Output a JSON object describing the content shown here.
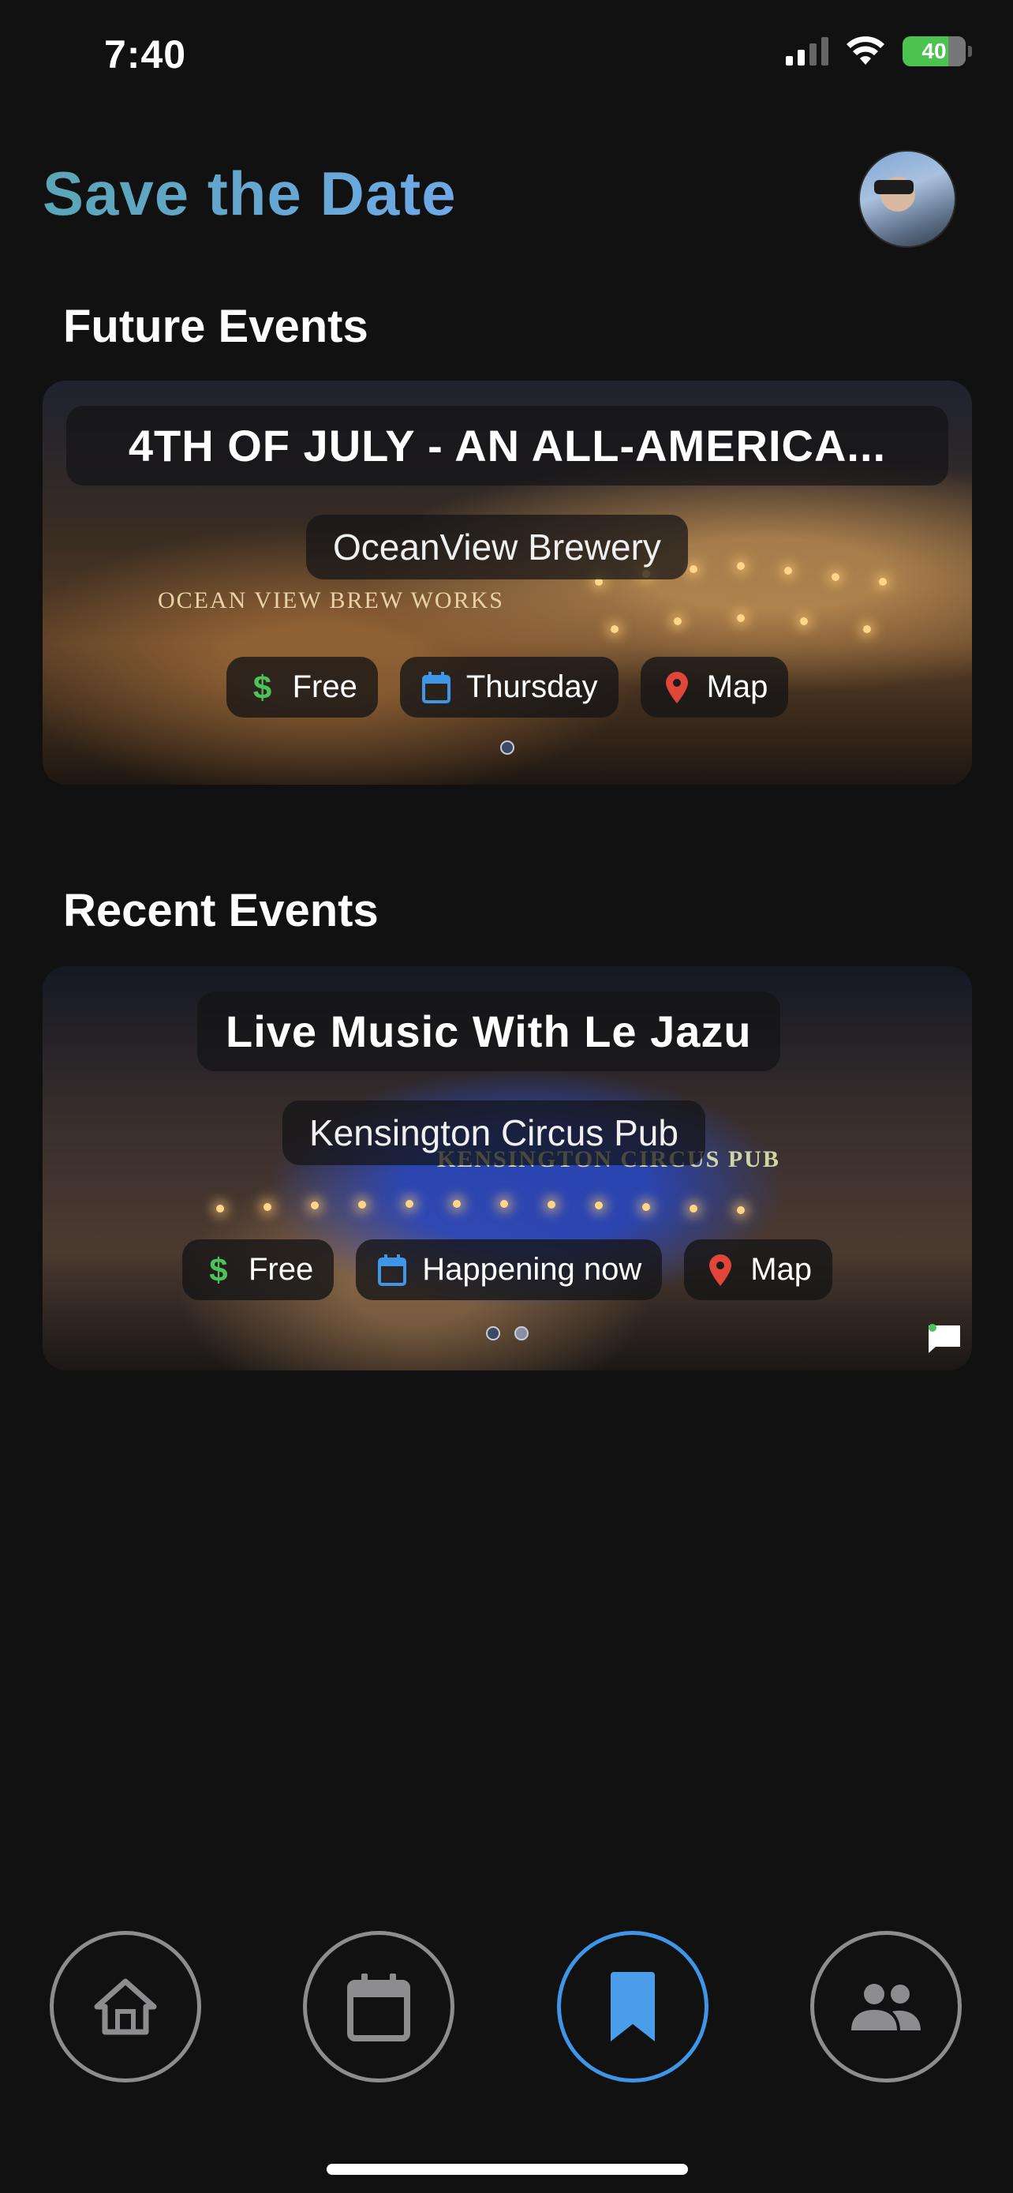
{
  "status": {
    "time": "7:40",
    "battery": "40"
  },
  "header": {
    "title": "Save the Date"
  },
  "sections": {
    "future": {
      "title": "Future Events",
      "event": {
        "title": "4TH OF JULY - AN ALL-AMERICA...",
        "venue": "OceanView Brewery",
        "sign": "OCEAN VIEW BREW WORKS",
        "price": "Free",
        "date": "Thursday",
        "map": "Map"
      }
    },
    "recent": {
      "title": "Recent Events",
      "event": {
        "title": "Live Music With Le Jazu",
        "venue": "Kensington Circus Pub",
        "sign": "KENSINGTON CIRCUS PUB",
        "price": "Free",
        "date": "Happening now",
        "map": "Map"
      }
    }
  },
  "colors": {
    "accent": "#3f95e6",
    "price_green": "#4cc35a",
    "calendar_blue": "#3f95e6",
    "map_red": "#e2463a"
  },
  "nav": [
    "home-icon",
    "calendar-icon",
    "bookmark-icon",
    "people-icon"
  ]
}
